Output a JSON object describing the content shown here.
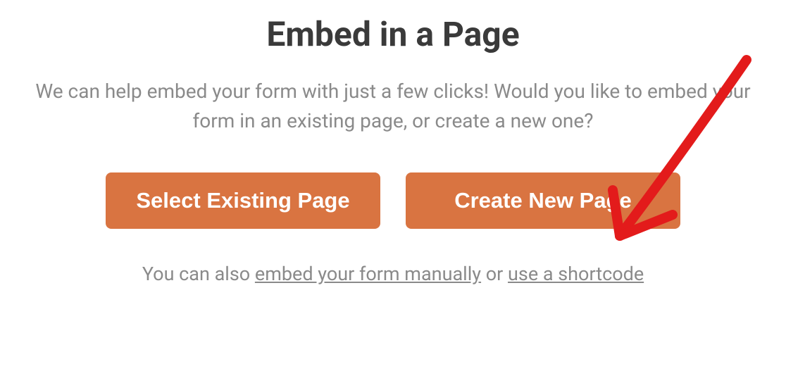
{
  "title": "Embed in a Page",
  "subtitle": "We can help embed your form with just a few clicks! Would you like to embed your form in an existing page, or create a new one?",
  "buttons": {
    "existing": "Select Existing Page",
    "create": "Create New Page"
  },
  "footer": {
    "prefix": "You can also ",
    "link_manual": "embed your form manually",
    "middle": " or ",
    "link_shortcode": "use a shortcode"
  },
  "annotation": {
    "color": "#e31b1b",
    "target": "create-new-page-button"
  }
}
